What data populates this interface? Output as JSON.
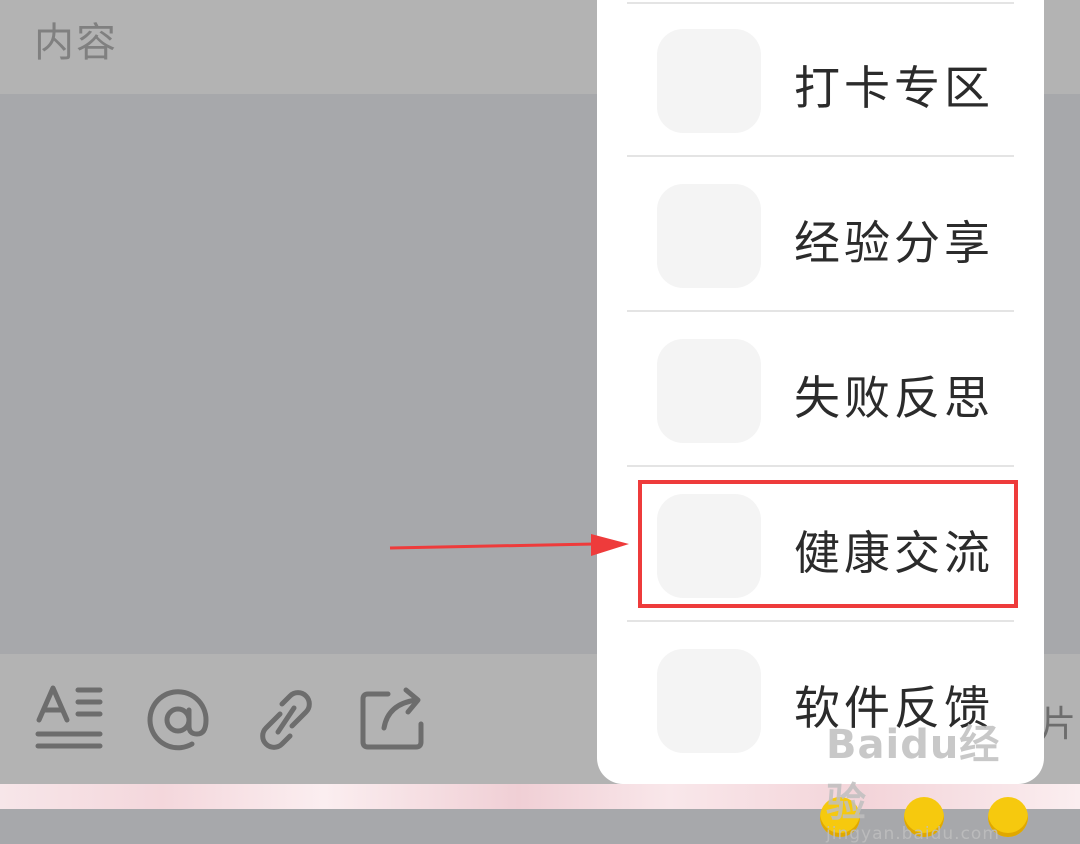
{
  "header": {
    "title": "内容"
  },
  "toolbar": {
    "tools": [
      {
        "icon": "text-format-icon"
      },
      {
        "icon": "at-mention-icon"
      },
      {
        "icon": "link-icon"
      },
      {
        "icon": "share-export-icon"
      }
    ],
    "trailing_label": "片"
  },
  "menu": {
    "items": [
      {
        "label": "打卡专区"
      },
      {
        "label": "经验分享"
      },
      {
        "label": "失败反思"
      },
      {
        "label": "健康交流"
      },
      {
        "label": "软件反馈"
      }
    ],
    "highlighted_index": 3
  },
  "annotation": {
    "color": "#ee3b3b"
  },
  "watermark": {
    "main": "Baidu经验",
    "sub": "jingyan.baidu.com"
  }
}
